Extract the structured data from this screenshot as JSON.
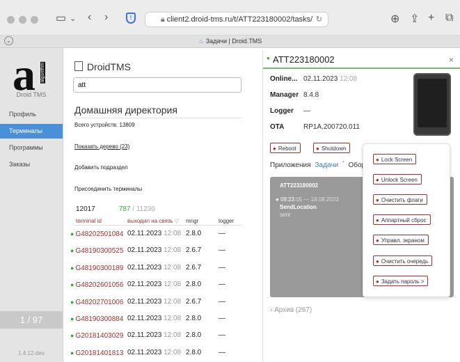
{
  "browser": {
    "url": "client2.droid-tms.ru/t/ATT223180002/tasks/",
    "tab_title": "Задачи | Droid.TMS"
  },
  "nav": {
    "logo_letter": "a",
    "logo_vertical": "algorithm",
    "logo_caption": "Droid TMS",
    "items": [
      {
        "label": "Профиль"
      },
      {
        "label": "Терминалы"
      },
      {
        "label": "Программы"
      },
      {
        "label": "Заказы"
      }
    ],
    "pager": "1 / 97",
    "version": "1.4.12-dev"
  },
  "main": {
    "app_title": "DroidTMS",
    "search_value": "att",
    "home_title": "Домашняя директория",
    "total_devices": "Всего устройств: 13809",
    "show_tree": "Показать дерево (23)",
    "add_subsection": "Добавить подраздел",
    "attach_terminals": "Присоединить терминалы",
    "count_total": "12017",
    "count_online": "787",
    "count_sep": " / ",
    "count_other": "11230",
    "columns": {
      "terminal_id": "terminal id",
      "last_seen": "выходил на связь",
      "mngr": "mngr",
      "logger": "logger"
    },
    "sort_indicator": "▽",
    "rows": [
      {
        "id": "G48202501084",
        "date": "02.11.2023",
        "time": "12:08",
        "mngr": "2.8.0",
        "logger": "—"
      },
      {
        "id": "G48190300525",
        "date": "02.11.2023",
        "time": "12:08",
        "mngr": "2.6.7",
        "logger": "—"
      },
      {
        "id": "G48190300189",
        "date": "02.11.2023",
        "time": "12:08",
        "mngr": "2.6.7",
        "logger": "—"
      },
      {
        "id": "G48202601056",
        "date": "02.11.2023",
        "time": "12:08",
        "mngr": "2.8.0",
        "logger": "—"
      },
      {
        "id": "G48202701006",
        "date": "02.11.2023",
        "time": "12:08",
        "mngr": "2.6.7",
        "logger": "—"
      },
      {
        "id": "G48190300884",
        "date": "02.11.2023",
        "time": "12:08",
        "mngr": "2.8.0",
        "logger": "—"
      },
      {
        "id": "G20181403029",
        "date": "02.11.2023",
        "time": "12:08",
        "mngr": "2.8.0",
        "logger": "—"
      },
      {
        "id": "G20181401813",
        "date": "02.11.2023",
        "time": "12:08",
        "mngr": "2.8.0",
        "logger": "—"
      }
    ]
  },
  "panel": {
    "title": "ATT223180002",
    "close": "×",
    "online_label": "Online...",
    "online_date": "02.11.2023",
    "online_time": "12:08",
    "manager_label": "Manager",
    "manager_value": "8.4.8",
    "logger_label": "Logger",
    "logger_value": "—",
    "ota_label": "OTA",
    "ota_value": "RP1A.200720.011",
    "reboot": "Reboot",
    "shutdown": "Shutdown",
    "tab_apps": "Приложения",
    "tab_tasks": "Задачи",
    "tab_tasks_mark": "*",
    "tab_equipment": "Обору",
    "task_title": "ATT223180002",
    "task_time": "09:23",
    "task_time_sec": ":05",
    "task_date": "— 18.08.2023",
    "task_cmd": "SendLocation",
    "task_status": "sent",
    "archive": "Архив (267)"
  },
  "menu": {
    "items": [
      {
        "label": "Lock Screen"
      },
      {
        "label": "Unlock Screen"
      },
      {
        "label": "Очистить флаги"
      },
      {
        "label": "Аппартный сброс"
      },
      {
        "label": "Управл. экраном"
      },
      {
        "label": "Очистить очередь"
      },
      {
        "label": "Задать пароль"
      }
    ],
    "more_arrow": ">"
  },
  "colors": {
    "accent_blue": "#4a90d9",
    "online_green": "#39a93c",
    "id_red": "#a0302e",
    "task_card_grey": "#9a9a9a"
  }
}
